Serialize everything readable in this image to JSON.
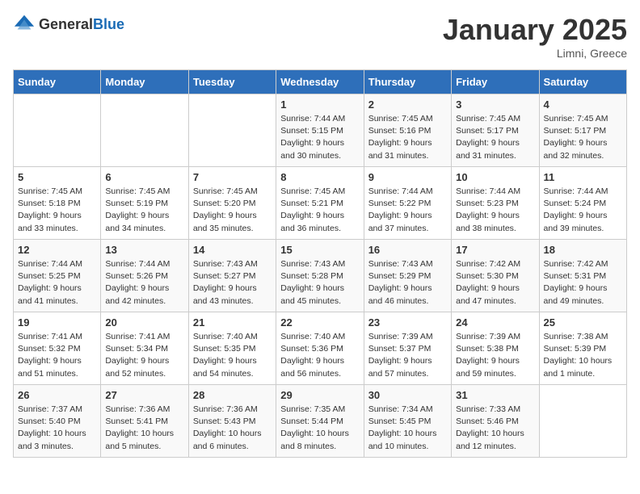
{
  "logo": {
    "general": "General",
    "blue": "Blue"
  },
  "title": "January 2025",
  "location": "Limni, Greece",
  "headers": [
    "Sunday",
    "Monday",
    "Tuesday",
    "Wednesday",
    "Thursday",
    "Friday",
    "Saturday"
  ],
  "weeks": [
    [
      {
        "day": "",
        "sunrise": "",
        "sunset": "",
        "daylight": ""
      },
      {
        "day": "",
        "sunrise": "",
        "sunset": "",
        "daylight": ""
      },
      {
        "day": "",
        "sunrise": "",
        "sunset": "",
        "daylight": ""
      },
      {
        "day": "1",
        "sunrise": "Sunrise: 7:44 AM",
        "sunset": "Sunset: 5:15 PM",
        "daylight": "Daylight: 9 hours and 30 minutes."
      },
      {
        "day": "2",
        "sunrise": "Sunrise: 7:45 AM",
        "sunset": "Sunset: 5:16 PM",
        "daylight": "Daylight: 9 hours and 31 minutes."
      },
      {
        "day": "3",
        "sunrise": "Sunrise: 7:45 AM",
        "sunset": "Sunset: 5:17 PM",
        "daylight": "Daylight: 9 hours and 31 minutes."
      },
      {
        "day": "4",
        "sunrise": "Sunrise: 7:45 AM",
        "sunset": "Sunset: 5:17 PM",
        "daylight": "Daylight: 9 hours and 32 minutes."
      }
    ],
    [
      {
        "day": "5",
        "sunrise": "Sunrise: 7:45 AM",
        "sunset": "Sunset: 5:18 PM",
        "daylight": "Daylight: 9 hours and 33 minutes."
      },
      {
        "day": "6",
        "sunrise": "Sunrise: 7:45 AM",
        "sunset": "Sunset: 5:19 PM",
        "daylight": "Daylight: 9 hours and 34 minutes."
      },
      {
        "day": "7",
        "sunrise": "Sunrise: 7:45 AM",
        "sunset": "Sunset: 5:20 PM",
        "daylight": "Daylight: 9 hours and 35 minutes."
      },
      {
        "day": "8",
        "sunrise": "Sunrise: 7:45 AM",
        "sunset": "Sunset: 5:21 PM",
        "daylight": "Daylight: 9 hours and 36 minutes."
      },
      {
        "day": "9",
        "sunrise": "Sunrise: 7:44 AM",
        "sunset": "Sunset: 5:22 PM",
        "daylight": "Daylight: 9 hours and 37 minutes."
      },
      {
        "day": "10",
        "sunrise": "Sunrise: 7:44 AM",
        "sunset": "Sunset: 5:23 PM",
        "daylight": "Daylight: 9 hours and 38 minutes."
      },
      {
        "day": "11",
        "sunrise": "Sunrise: 7:44 AM",
        "sunset": "Sunset: 5:24 PM",
        "daylight": "Daylight: 9 hours and 39 minutes."
      }
    ],
    [
      {
        "day": "12",
        "sunrise": "Sunrise: 7:44 AM",
        "sunset": "Sunset: 5:25 PM",
        "daylight": "Daylight: 9 hours and 41 minutes."
      },
      {
        "day": "13",
        "sunrise": "Sunrise: 7:44 AM",
        "sunset": "Sunset: 5:26 PM",
        "daylight": "Daylight: 9 hours and 42 minutes."
      },
      {
        "day": "14",
        "sunrise": "Sunrise: 7:43 AM",
        "sunset": "Sunset: 5:27 PM",
        "daylight": "Daylight: 9 hours and 43 minutes."
      },
      {
        "day": "15",
        "sunrise": "Sunrise: 7:43 AM",
        "sunset": "Sunset: 5:28 PM",
        "daylight": "Daylight: 9 hours and 45 minutes."
      },
      {
        "day": "16",
        "sunrise": "Sunrise: 7:43 AM",
        "sunset": "Sunset: 5:29 PM",
        "daylight": "Daylight: 9 hours and 46 minutes."
      },
      {
        "day": "17",
        "sunrise": "Sunrise: 7:42 AM",
        "sunset": "Sunset: 5:30 PM",
        "daylight": "Daylight: 9 hours and 47 minutes."
      },
      {
        "day": "18",
        "sunrise": "Sunrise: 7:42 AM",
        "sunset": "Sunset: 5:31 PM",
        "daylight": "Daylight: 9 hours and 49 minutes."
      }
    ],
    [
      {
        "day": "19",
        "sunrise": "Sunrise: 7:41 AM",
        "sunset": "Sunset: 5:32 PM",
        "daylight": "Daylight: 9 hours and 51 minutes."
      },
      {
        "day": "20",
        "sunrise": "Sunrise: 7:41 AM",
        "sunset": "Sunset: 5:34 PM",
        "daylight": "Daylight: 9 hours and 52 minutes."
      },
      {
        "day": "21",
        "sunrise": "Sunrise: 7:40 AM",
        "sunset": "Sunset: 5:35 PM",
        "daylight": "Daylight: 9 hours and 54 minutes."
      },
      {
        "day": "22",
        "sunrise": "Sunrise: 7:40 AM",
        "sunset": "Sunset: 5:36 PM",
        "daylight": "Daylight: 9 hours and 56 minutes."
      },
      {
        "day": "23",
        "sunrise": "Sunrise: 7:39 AM",
        "sunset": "Sunset: 5:37 PM",
        "daylight": "Daylight: 9 hours and 57 minutes."
      },
      {
        "day": "24",
        "sunrise": "Sunrise: 7:39 AM",
        "sunset": "Sunset: 5:38 PM",
        "daylight": "Daylight: 9 hours and 59 minutes."
      },
      {
        "day": "25",
        "sunrise": "Sunrise: 7:38 AM",
        "sunset": "Sunset: 5:39 PM",
        "daylight": "Daylight: 10 hours and 1 minute."
      }
    ],
    [
      {
        "day": "26",
        "sunrise": "Sunrise: 7:37 AM",
        "sunset": "Sunset: 5:40 PM",
        "daylight": "Daylight: 10 hours and 3 minutes."
      },
      {
        "day": "27",
        "sunrise": "Sunrise: 7:36 AM",
        "sunset": "Sunset: 5:41 PM",
        "daylight": "Daylight: 10 hours and 5 minutes."
      },
      {
        "day": "28",
        "sunrise": "Sunrise: 7:36 AM",
        "sunset": "Sunset: 5:43 PM",
        "daylight": "Daylight: 10 hours and 6 minutes."
      },
      {
        "day": "29",
        "sunrise": "Sunrise: 7:35 AM",
        "sunset": "Sunset: 5:44 PM",
        "daylight": "Daylight: 10 hours and 8 minutes."
      },
      {
        "day": "30",
        "sunrise": "Sunrise: 7:34 AM",
        "sunset": "Sunset: 5:45 PM",
        "daylight": "Daylight: 10 hours and 10 minutes."
      },
      {
        "day": "31",
        "sunrise": "Sunrise: 7:33 AM",
        "sunset": "Sunset: 5:46 PM",
        "daylight": "Daylight: 10 hours and 12 minutes."
      },
      {
        "day": "",
        "sunrise": "",
        "sunset": "",
        "daylight": ""
      }
    ]
  ]
}
